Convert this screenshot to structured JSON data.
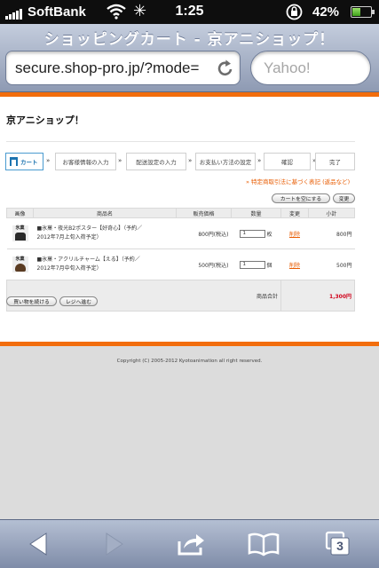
{
  "status_bar": {
    "carrier": "SoftBank",
    "time": "1:25",
    "battery_percent": "42%",
    "battery_level": 0.42
  },
  "browser": {
    "page_title": "ショッピングカート - 京アニショップ！",
    "url": "secure.shop-pro.jp/?mode=",
    "search_placeholder": "Yahoo!",
    "tab_count": "3"
  },
  "page": {
    "shop_name": "京アニショップ！",
    "steps": [
      "カート",
      "お客様情報の入力",
      "配送設定の入力",
      "お支払い方法の設定",
      "確認",
      "完了"
    ],
    "tokusho_link": "» 特定商取引法に基づく表記 (返品など)",
    "empty_cart_button": "カートを空にする",
    "update_button": "変更",
    "table_headers": [
      "画像",
      "商品名",
      "販売価格",
      "数量",
      "変更",
      "小計"
    ],
    "items": [
      {
        "thumb_text": "氷菓",
        "name_line1": "■氷菓・夜光B2ポスター【好奇心】（予約／",
        "name_line2": "2012年7月上旬入荷予定）",
        "price": "800円(税込)",
        "quantity": "1",
        "unit": "枚",
        "delete_label": "削除",
        "subtotal": "800円"
      },
      {
        "thumb_text": "氷菓",
        "name_line1": "■氷菓・アクリルチャーム【える】（予約／",
        "name_line2": "2012年7月中旬入荷予定）",
        "price": "500円(税込)",
        "quantity": "1",
        "unit": "個",
        "delete_label": "削除",
        "subtotal": "500円"
      }
    ],
    "total_label": "商品合計",
    "total_amount": "1,300円",
    "continue_shopping_button": "買い物を続ける",
    "checkout_button": "レジへ進む",
    "copyright": "Copyright (C) 2005-2012 Kyotoanimation all right reserved."
  },
  "toolbar": {
    "icons": [
      "back-arrow-icon",
      "forward-arrow-icon",
      "share-icon",
      "bookmarks-icon",
      "tabs-icon"
    ]
  },
  "colors": {
    "accent_orange": "#f26d0c",
    "link_orange": "#e85b00",
    "total_red": "#d0021b",
    "step_blue": "#1d74b0"
  }
}
